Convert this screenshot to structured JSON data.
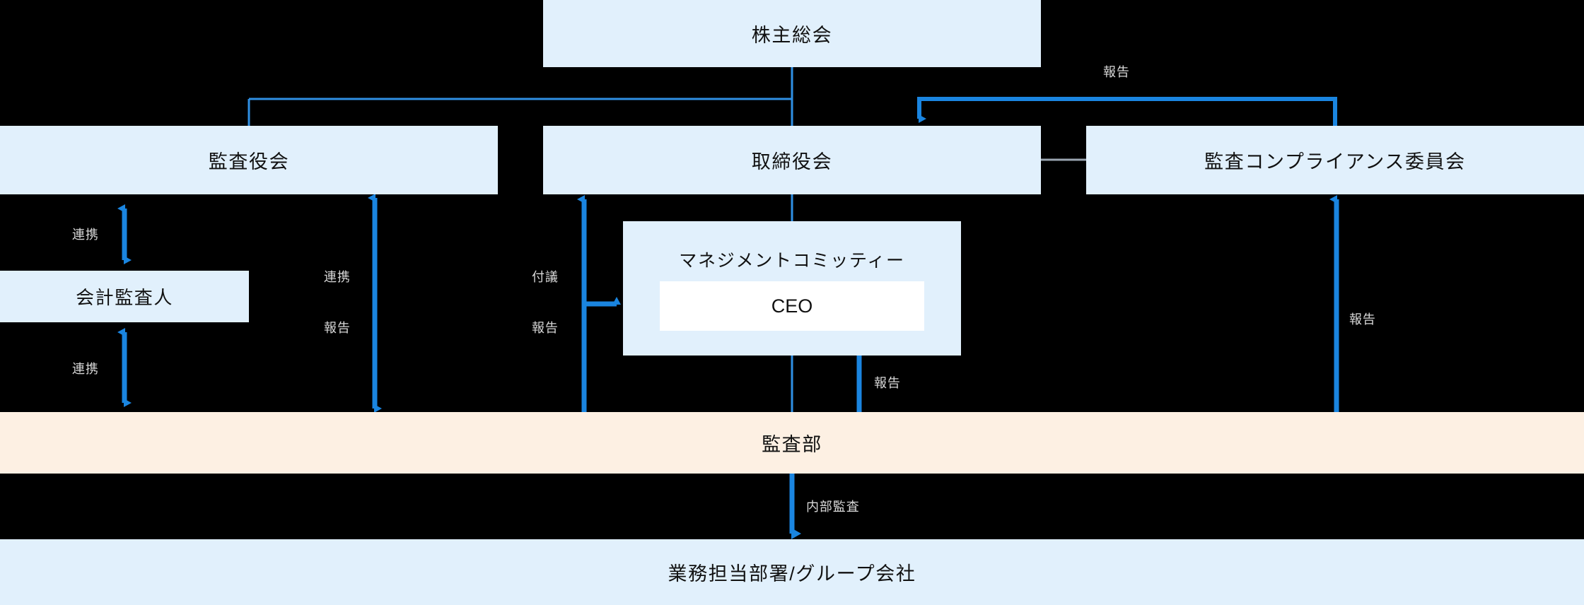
{
  "diagram": {
    "title_context": "corporate-governance-structure",
    "colors": {
      "background": "#000000",
      "box_fill": "#e1f0fc",
      "bar_audit_fill": "#fdf0e3",
      "ceo_fill": "#ffffff",
      "arrow_blue": "#1a85e0",
      "thin_link_blue": "#2f8fe3",
      "gray_link": "#9aa5b1",
      "label_text": "#d8d8d8",
      "box_text": "#111111"
    },
    "nodes": {
      "shareholders_meeting": "株主総会",
      "board_of_auditors": "監査役会",
      "board_of_directors": "取締役会",
      "audit_compliance_committee": "監査コンプライアンス委員会",
      "accounting_auditor": "会計監査人",
      "management_committee": "マネジメントコミッティー",
      "ceo": "CEO",
      "audit_department": "監査部",
      "operating_departments": "業務担当部署/グループ会社"
    },
    "edge_labels": {
      "report_top_right": "報告",
      "coordination_auditors_accounting": "連携",
      "coordination_accounting_audit_dept": "連携",
      "coordination_auditors_audit_dept": "連携",
      "report_auditors_audit_dept": "報告",
      "deliberation_directors": "付議",
      "report_directors": "報告",
      "report_ceo": "報告",
      "report_compliance": "報告",
      "internal_audit": "内部監査"
    }
  }
}
